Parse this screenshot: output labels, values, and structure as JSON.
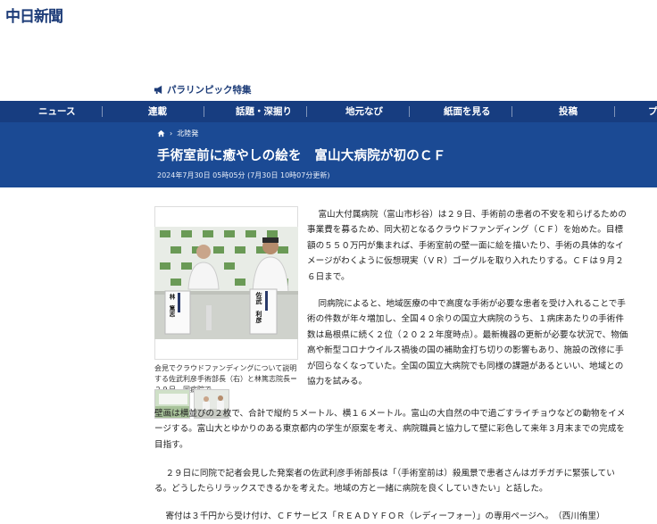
{
  "site": {
    "logo": "中日新聞"
  },
  "special_link": {
    "label": "パラリンピック特集",
    "icon": "megaphone-icon"
  },
  "nav": {
    "items": [
      "ニュース",
      "連載",
      "話題・深掘り",
      "地元なび",
      "紙面を見る",
      "投稿",
      "プ"
    ]
  },
  "breadcrumb": {
    "home_icon": "home-icon",
    "section": "北陸発"
  },
  "article": {
    "title": "手術室前に癒やしの絵を　富山大病院が初のＣＦ",
    "date": "2024年7月30日 05時05分 (7月30日 10時07分更新)",
    "photo_labels": {
      "left": "林　篤志",
      "right": "佐武　利彦"
    },
    "caption": "会見でクラウドファンディングについて説明する佐武利彦手術部長（右）と林篤志院長＝２９日、同病院で",
    "paragraphs": [
      "富山大付属病院（富山市杉谷）は２９日、手術前の患者の不安を和らげるための事業費を募るため、同大初となるクラウドファンディング（ＣＦ）を始めた。目標額の５５０万円が集まれば、手術室前の壁一面に絵を描いたり、手術の具体的なイメージがわくように仮想現実（ＶＲ）ゴーグルを取り入れたりする。ＣＦは９月２６日まで。",
      "同病院によると、地域医療の中で高度な手術が必要な患者を受け入れることで手術の件数が年々増加し、全国４０余りの国立大病院のうち、１病床あたりの手術件数は島根県に続く２位（２０２２年度時点）。最新機器の更新が必要な状況で、物価高や新型コロナウイルス禍後の国の補助金打ち切りの影響もあり、施設の改修に手が回らなくなっていた。全国の国立大病院でも同様の課題があるといい、地域との協力を試みる。",
      "壁画は横並びの２枚で、合計で縦約５メートル、横１６メートル。富山の大自然の中で過ごすライチョウなどの動物をイメージする。富山大とゆかりのある東京都内の学生が原案を考え、病院職員と協力して壁に彩色して来年３月末までの完成を目指す。",
      "２９日に同院で記者会見した発案者の佐武利彦手術部長は「（手術室前は）殺風景で患者さんはガチガチに緊張している。どうしたらリラックスできるかを考えた。地域の方と一緒に病院を良くしていきたい」と話した。",
      "寄付は３千円から受け付け、ＣＦサービス「ＲＥＡＤＹＦＯＲ（レディーフォー）」の専用ページへ。　（西川侑里）"
    ]
  },
  "colors": {
    "nav_bg": "#173d80",
    "header_bg": "#1b4a94",
    "brand": "#1d3c78"
  }
}
